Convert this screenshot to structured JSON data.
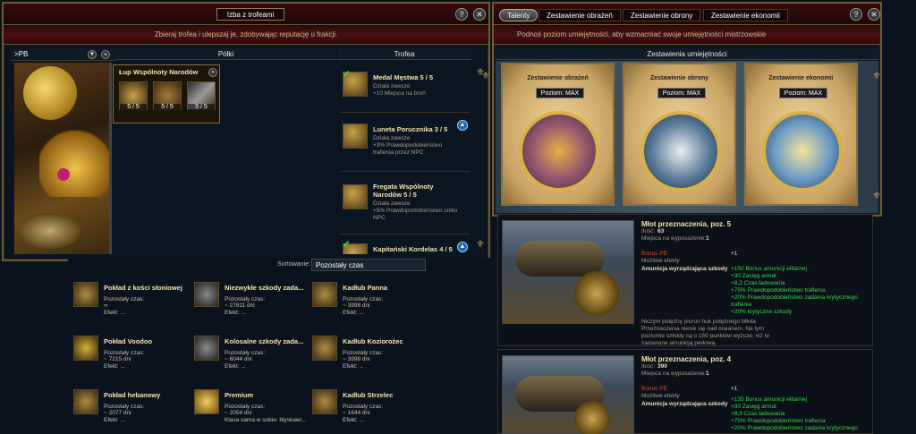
{
  "trophies_window": {
    "title": "Izba z trofeami",
    "subtitle": "Zbieraj trofea i ulepszaj je, zdobywając reputację u frakcji.",
    "dropdown": ">PB",
    "shelves_header": "Półki",
    "trophies_header": "Trofea",
    "shelf": {
      "name": "Łup Wspólnoty Narodów",
      "slots": [
        "5 / 5",
        "5 / 5",
        "5 / 5"
      ]
    },
    "trophies": [
      {
        "name": "Medal Męstwa 5 / 5",
        "l1": "Działa zawsze",
        "l2": "+10 Miejsca na broń",
        "l3": "",
        "l4": ""
      },
      {
        "name": "Luneta Porucznika 3 / 5",
        "l1": "Działa zawsze",
        "l2": "+3% Prawdopodobieństwo",
        "l3": "trafienia przez NPC",
        "l4": ""
      },
      {
        "name": "Fregata Wspólnoty",
        "name2": "Narodów 5 / 5",
        "l1": "Działa zawsze",
        "l2": "+5% Prawdopodobieństwo uniku",
        "l3": "NPC",
        "l4": ""
      },
      {
        "name": "Kapitański Kordelas 4 / 5",
        "l1": "",
        "l2": "",
        "l3": "",
        "l4": ""
      }
    ]
  },
  "inventory": {
    "sort_label": "Sortowanie:",
    "sort_value": "Pozostały czas",
    "items": [
      {
        "name": "Pokład z kości słoniowej",
        "l1": "Pozostały czas:",
        "l2": "∞",
        "l3": "Efekt: ..."
      },
      {
        "name": "Niezwykłe szkody zada...",
        "l1": "Pozostały czas:",
        "l2": "~ 27811 dni",
        "l3": "Efekt: ..."
      },
      {
        "name": "Kadłub Panna",
        "l1": "Pozostały czas:",
        "l2": "~ 3998 dni",
        "l3": "Efekt: ..."
      },
      {
        "name": "Pokład Voodoo",
        "l1": "Pozostały czas:",
        "l2": "~ 7215 dni",
        "l3": "Efekt: ..."
      },
      {
        "name": "Kolosalne szkody zada...",
        "l1": "Pozostały czas:",
        "l2": "~ 6044 dni",
        "l3": "Efekt: ..."
      },
      {
        "name": "Kadłub Koziorożec",
        "l1": "Pozostały czas:",
        "l2": "~ 3998 dni",
        "l3": "Efekt: ..."
      },
      {
        "name": "Pokład hebanowy",
        "l1": "Pozostały czas:",
        "l2": "~ 2077 dni",
        "l3": "Efekt: ..."
      },
      {
        "name": "Premium",
        "l1": "Pozostały czas:",
        "l2": "~ 2054 dni",
        "l3": "Klasa sama w sobie: błyskawi..."
      },
      {
        "name": "Kadłub Strzelec",
        "l1": "Pozostały czas:",
        "l2": "~ 1644 dni",
        "l3": "Efekt: ..."
      }
    ]
  },
  "skills_window": {
    "tabs": [
      "Talenty",
      "Zestawienie obrażeń",
      "Zestawienie obrony",
      "Zestawienie ekonomii"
    ],
    "subtitle": "Podnoś poziom umiejętności, aby wzmacniać swoje umiejętności mistrzowskie",
    "header": "Zestawienia umiejętności",
    "cards": [
      {
        "title": "Zestawienie obrażeń",
        "level": "Poziom: MAX"
      },
      {
        "title": "Zestawienie obrony",
        "level": "Poziom: MAX"
      },
      {
        "title": "Zestawienie ekonomii",
        "level": "Poziom: MAX"
      }
    ]
  },
  "tooltips": [
    {
      "title": "Młot przeznaczenia, poz. 5",
      "qty_label": "Ilość:",
      "qty": "63",
      "slots_label": "Miejsca na wyposażenie:",
      "slots": "1",
      "bonus_pe": "Bonus PE",
      "bonus_pe_val": "+1",
      "possible": "Możliwe efekty",
      "ammo": "Amunicja wyrządzająca szkody",
      "effects": [
        "+150 Bonus amunicji elitarnej",
        "+30 Zasięg armat",
        "+8,2 Czas ładowania",
        "+75% Prawdopodobieństwo trafienia",
        "+20% Prawdopodobieństwo zadania krytycznego",
        "trafienia",
        "+20% krytyczne szkody"
      ],
      "desc": [
        "Niczym potężny piorun huk potężnego Młota",
        "Przeznaczenia niesie się nad oceanem. Na tym",
        "poziomie szkody są o 150 punktów wyższe, niż te",
        "zadawane amunicją perłową."
      ]
    },
    {
      "title": "Młot przeznaczenia, poz. 4",
      "qty_label": "Ilość:",
      "qty": "390",
      "slots_label": "Miejsca na wyposażenie:",
      "slots": "1",
      "bonus_pe": "Bonus PE",
      "bonus_pe_val": "+1",
      "possible": "Możliwe efekty",
      "ammo": "Amunicja wyrządzająca szkody",
      "effects": [
        "+135 Bonus amunicji elitarnej",
        "+30 Zasięg armat",
        "+8,3 Czas ładowania",
        "+75% Prawdopodobieństwo trafienia",
        "+20% Prawdopodobieństwo zadania krytycznego"
      ],
      "desc": []
    }
  ]
}
